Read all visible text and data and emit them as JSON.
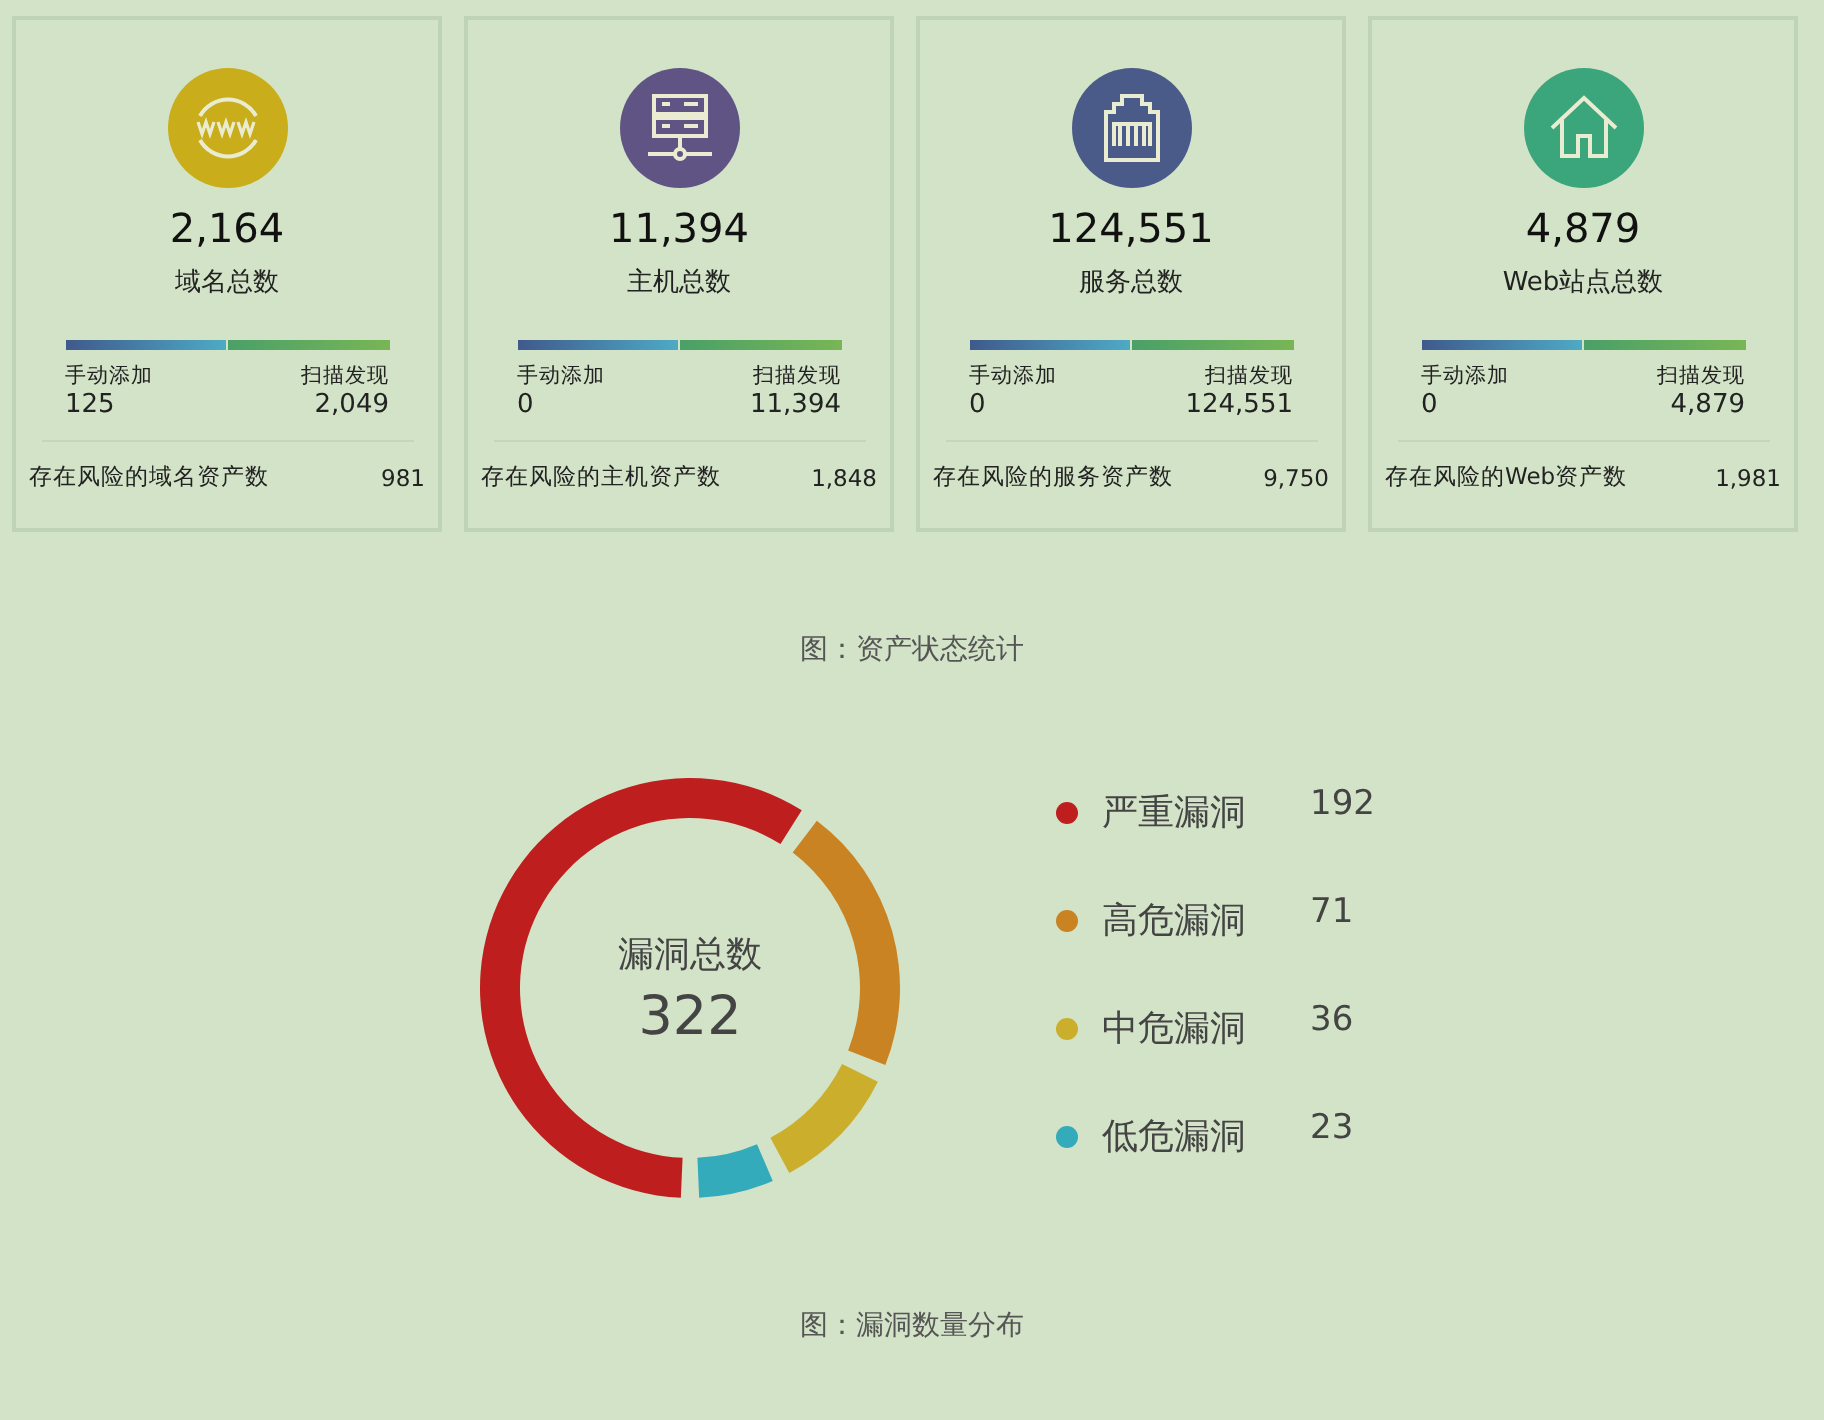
{
  "asset_cards": [
    {
      "total": "2,164",
      "label": "域名总数",
      "manual_label": "手动添加",
      "manual_value": "125",
      "scan_label": "扫描发现",
      "scan_value": "2,049",
      "risk_label": "存在风险的域名资产数",
      "risk_value": "981"
    },
    {
      "total": "11,394",
      "label": "主机总数",
      "manual_label": "手动添加",
      "manual_value": "0",
      "scan_label": "扫描发现",
      "scan_value": "11,394",
      "risk_label": "存在风险的主机资产数",
      "risk_value": "1,848"
    },
    {
      "total": "124,551",
      "label": "服务总数",
      "manual_label": "手动添加",
      "manual_value": "0",
      "scan_label": "扫描发现",
      "scan_value": "124,551",
      "risk_label": "存在风险的服务资产数",
      "risk_value": "9,750"
    },
    {
      "total": "4,879",
      "label": "Web站点总数",
      "manual_label": "手动添加",
      "manual_value": "0",
      "scan_label": "扫描发现",
      "scan_value": "4,879",
      "risk_label": "存在风险的Web资产数",
      "risk_value": "1,981"
    }
  ],
  "asset_caption": "图：资产状态统计",
  "vuln_chart": {
    "center_label": "漏洞总数",
    "center_value": "322",
    "legend": [
      {
        "label": "严重漏洞",
        "value": "192",
        "color": "#be1e1e"
      },
      {
        "label": "高危漏洞",
        "value": "71",
        "color": "#c98323"
      },
      {
        "label": "中危漏洞",
        "value": "36",
        "color": "#cbae2c"
      },
      {
        "label": "低危漏洞",
        "value": "23",
        "color": "#33abbb"
      }
    ]
  },
  "vuln_caption": "图：漏洞数量分布"
}
